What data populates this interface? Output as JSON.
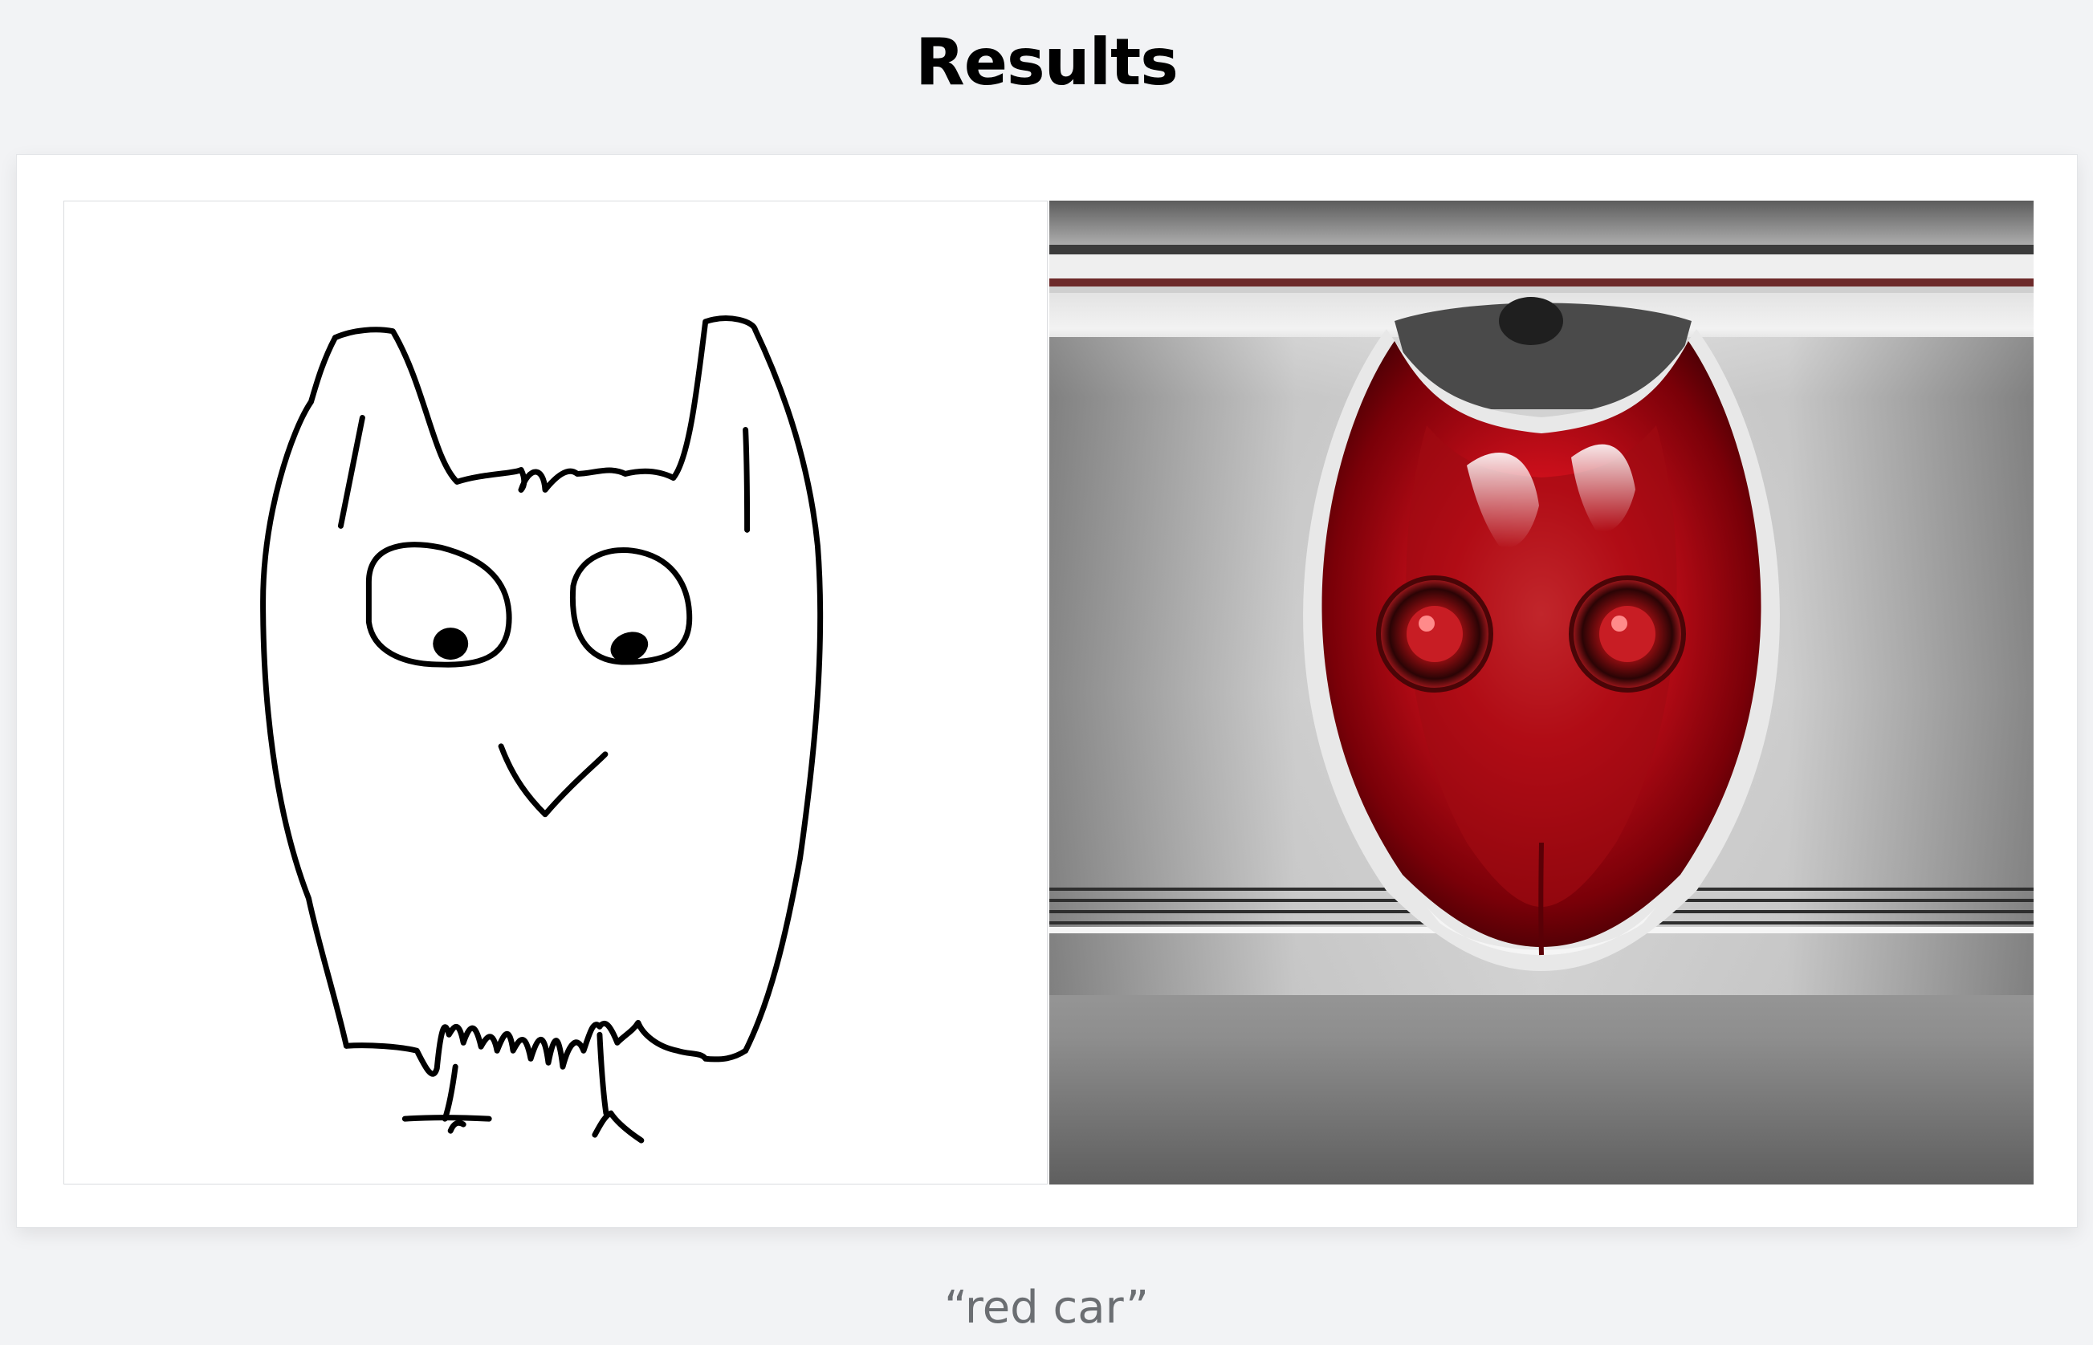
{
  "header": {
    "title": "Results"
  },
  "results": {
    "sketch": {
      "icon": "owl-sketch-icon"
    },
    "generated_image": {
      "icon": "red-car-rear-image"
    },
    "prompt_caption": "“red car”"
  },
  "colors": {
    "background": "#f2f3f5",
    "card": "#ffffff",
    "caption": "#6b6e72",
    "accent_red": "#c8101c"
  }
}
